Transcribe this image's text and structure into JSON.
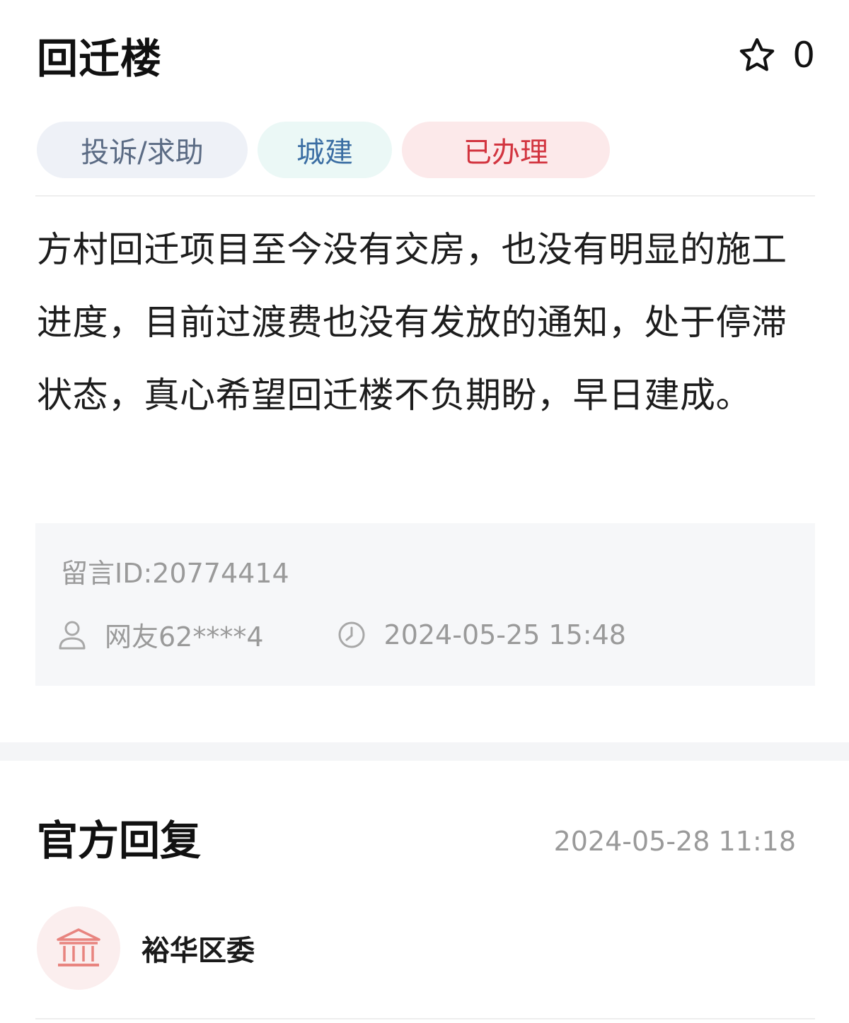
{
  "header": {
    "title": "回迁楼",
    "favorite_icon": "star-outline-icon",
    "favorite_count": "0"
  },
  "tags": [
    {
      "label": "投诉/求助",
      "bg": "#eef1f7",
      "color": "#5b6b84"
    },
    {
      "label": "城建",
      "bg": "#ebf8f6",
      "color": "#3b6ea3"
    },
    {
      "label": "已办理",
      "bg": "#fce9ea",
      "color": "#d2343f"
    }
  ],
  "message": {
    "body": " 方村回迁项目至今没有交房，也没有明显的施工进度，目前过渡费也没有发放的通知，处于停滞状态，真心希望回迁楼不负期盼，早日建成。",
    "id_label": "留言ID:20774414",
    "author_icon": "user-icon",
    "author": "网友62****4",
    "time_icon": "clock-icon",
    "time": "2024-05-25 15:48"
  },
  "official_reply": {
    "title": "官方回复",
    "time": "2024-05-28 11:18",
    "org_icon": "government-building-icon",
    "org_name": "裕华区委"
  },
  "colors": {
    "muted_text": "#9a9a9a",
    "panel_bg": "#f6f7f9",
    "org_icon": "#e8847f"
  }
}
